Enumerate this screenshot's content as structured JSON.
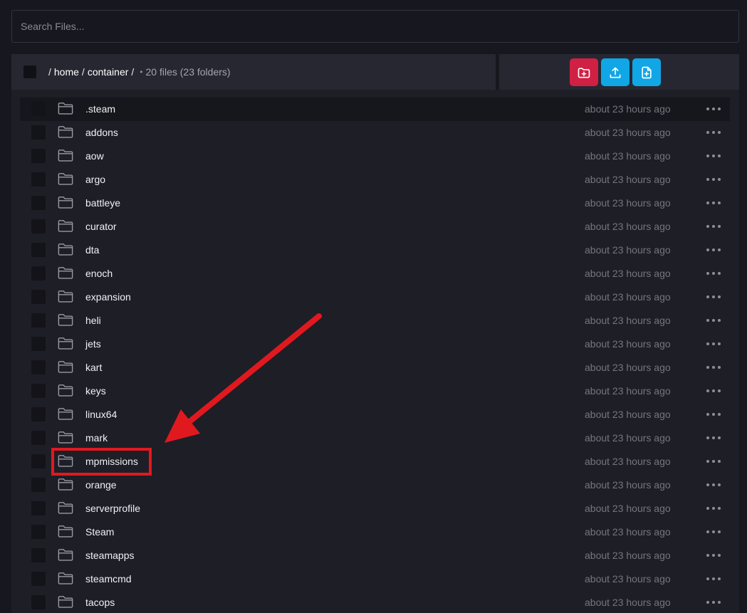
{
  "search": {
    "placeholder": "Search Files..."
  },
  "breadcrumb": {
    "parts": [
      "home",
      "container"
    ],
    "summary": "20 files (23 folders)"
  },
  "actions": [
    {
      "name": "create-folder",
      "icon": "folder-plus-icon",
      "color": "#d02043"
    },
    {
      "name": "upload",
      "icon": "upload-icon",
      "color": "#11a6e6"
    },
    {
      "name": "new-file",
      "icon": "file-plus-icon",
      "color": "#11a6e6"
    }
  ],
  "files": [
    {
      "name": ".steam",
      "modified": "about 23 hours ago"
    },
    {
      "name": "addons",
      "modified": "about 23 hours ago"
    },
    {
      "name": "aow",
      "modified": "about 23 hours ago"
    },
    {
      "name": "argo",
      "modified": "about 23 hours ago"
    },
    {
      "name": "battleye",
      "modified": "about 23 hours ago"
    },
    {
      "name": "curator",
      "modified": "about 23 hours ago"
    },
    {
      "name": "dta",
      "modified": "about 23 hours ago"
    },
    {
      "name": "enoch",
      "modified": "about 23 hours ago"
    },
    {
      "name": "expansion",
      "modified": "about 23 hours ago"
    },
    {
      "name": "heli",
      "modified": "about 23 hours ago"
    },
    {
      "name": "jets",
      "modified": "about 23 hours ago"
    },
    {
      "name": "kart",
      "modified": "about 23 hours ago"
    },
    {
      "name": "keys",
      "modified": "about 23 hours ago"
    },
    {
      "name": "linux64",
      "modified": "about 23 hours ago"
    },
    {
      "name": "mark",
      "modified": "about 23 hours ago"
    },
    {
      "name": "mpmissions",
      "modified": "about 23 hours ago"
    },
    {
      "name": "orange",
      "modified": "about 23 hours ago"
    },
    {
      "name": "serverprofile",
      "modified": "about 23 hours ago"
    },
    {
      "name": "Steam",
      "modified": "about 23 hours ago"
    },
    {
      "name": "steamapps",
      "modified": "about 23 hours ago"
    },
    {
      "name": "steamcmd",
      "modified": "about 23 hours ago"
    },
    {
      "name": "tacops",
      "modified": "about 23 hours ago"
    }
  ],
  "annotation": {
    "highlight_color": "#e0191f",
    "highlighted_item": "mpmissions"
  }
}
